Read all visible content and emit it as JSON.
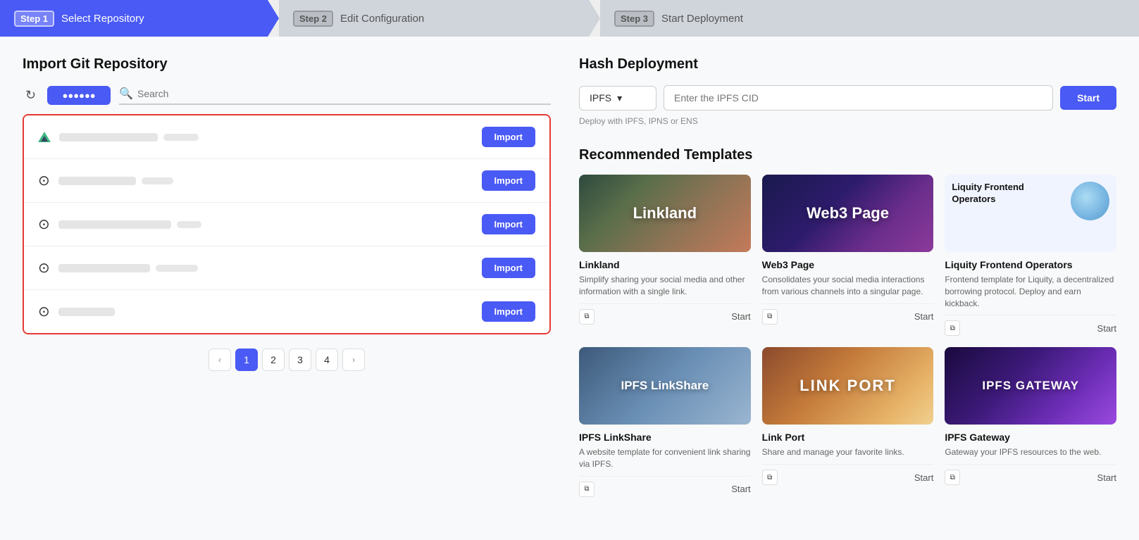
{
  "steps": [
    {
      "id": "step1",
      "num": "Step 1",
      "label": "Select Repository",
      "state": "active"
    },
    {
      "id": "step2",
      "num": "Step 2",
      "label": "Edit Configuration",
      "state": "inactive"
    },
    {
      "id": "step3",
      "num": "Step 3",
      "label": "Start Deployment",
      "state": "inactive"
    }
  ],
  "left": {
    "section_title": "Import Git Repository",
    "search_placeholder": "Search",
    "repos": [
      {
        "icon": "vue",
        "import_label": "Import"
      },
      {
        "icon": "github",
        "import_label": "Import"
      },
      {
        "icon": "github",
        "import_label": "Import"
      },
      {
        "icon": "github",
        "import_label": "Import"
      },
      {
        "icon": "github",
        "import_label": "Import"
      }
    ],
    "pagination": {
      "prev": "‹",
      "pages": [
        "1",
        "2",
        "3",
        "4"
      ],
      "next": "›",
      "active": "1"
    }
  },
  "right": {
    "hash_deployment": {
      "section_title": "Hash Deployment",
      "select_label": "IPFS",
      "input_placeholder": "Enter the IPFS CID",
      "start_label": "Start",
      "hint": "Deploy with IPFS, IPNS or ENS"
    },
    "templates": {
      "section_title": "Recommended Templates",
      "items": [
        {
          "id": "linkland",
          "name": "Linkland",
          "desc": "Simplify sharing your social media and other information with a single link.",
          "start_label": "Start",
          "thumb_style": "linkland",
          "thumb_text": "Linkland"
        },
        {
          "id": "web3page",
          "name": "Web3 Page",
          "desc": "Consolidates your social media interactions from various channels into a singular page.",
          "start_label": "Start",
          "thumb_style": "web3page",
          "thumb_text": "Web3 Page"
        },
        {
          "id": "liquity",
          "name": "Liquity Frontend Operators",
          "desc": "Frontend template for Liquity, a decentralized borrowing protocol. Deploy and earn kickback.",
          "start_label": "Start",
          "thumb_style": "liquity",
          "thumb_text": "Liquity Frontend\nOperators"
        },
        {
          "id": "ipfs-linkshare",
          "name": "IPFS LinkShare",
          "desc": "A website template for convenient link sharing via IPFS.",
          "start_label": "Start",
          "thumb_style": "ipfs-linkshare",
          "thumb_text": "IPFS LinkShare"
        },
        {
          "id": "linkport",
          "name": "Link Port",
          "desc": "Share and manage your favorite links.",
          "start_label": "Start",
          "thumb_style": "linkport",
          "thumb_text": "LINK PORT"
        },
        {
          "id": "ipfs-gateway",
          "name": "IPFS Gateway",
          "desc": "Gateway your IPFS resources to the web.",
          "start_label": "Start",
          "thumb_style": "ipfs-gateway",
          "thumb_text": "IPFS GATEWAY"
        }
      ]
    }
  }
}
